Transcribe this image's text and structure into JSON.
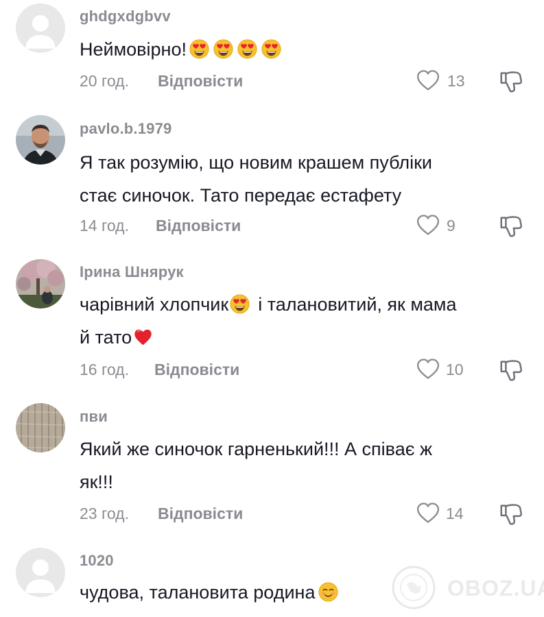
{
  "comments": [
    {
      "username": "ghdgxdgbvv",
      "text": "Неймовірно!",
      "text2": "",
      "time": "20 год.",
      "reply": "Відповісти",
      "likes": "13",
      "avatar": "default-avatar",
      "emojis": [
        "heart-eyes-emoji",
        "heart-eyes-emoji",
        "heart-eyes-emoji",
        "heart-eyes-emoji"
      ]
    },
    {
      "username": "pavlo.b.1979",
      "text": "Я так розумію, що новим крашем публіки",
      "text2": "стає синочок. Тато передає естафету",
      "time": "14 год.",
      "reply": "Відповісти",
      "likes": "9",
      "avatar": "man-photo-avatar"
    },
    {
      "username": "Ірина Шнярук",
      "text": "чарівний хлопчик",
      "text_after": "і талановитий, як мама",
      "text2": "й тато",
      "time": "16 год.",
      "reply": "Відповісти",
      "likes": "10",
      "avatar": "blossom-tree-photo-avatar",
      "emojis": [
        "heart-eyes-emoji",
        "red-heart-emoji"
      ]
    },
    {
      "username": "пви",
      "text": "Який же синочок гарненький!!! А співає ж",
      "text2": "як!!!",
      "time": "23 год.",
      "reply": "Відповісти",
      "likes": "14",
      "avatar": "knit-texture-avatar"
    },
    {
      "username": "1020",
      "text": "чудова, талановита родина",
      "avatar": "default-avatar",
      "emojis": [
        "smiling-blush-emoji"
      ]
    }
  ],
  "icons": {
    "like": "heart-outline-icon",
    "dislike": "thumbs-down-icon"
  },
  "colors": {
    "text": "#161823",
    "secondary": "#8a8b91",
    "background": "#ffffff"
  },
  "watermark": "OBOZ.UA"
}
